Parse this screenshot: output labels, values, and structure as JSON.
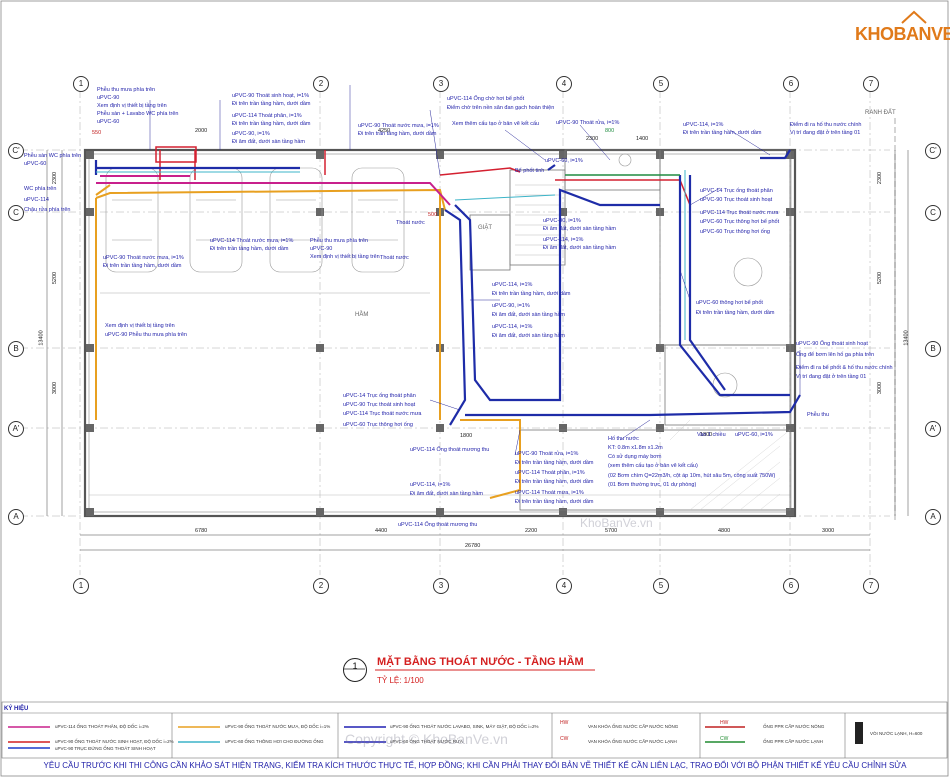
{
  "logo": {
    "text": "KHOBANVE"
  },
  "title": {
    "main": "MẶT BẰNG THOÁT NƯỚC - TẦNG HẦM",
    "scale": "TỶ LỆ: 1/100",
    "number": "1"
  },
  "grid": {
    "top_cols": [
      "1",
      "2",
      "3",
      "4",
      "5",
      "6",
      "7"
    ],
    "bottom_cols": [
      "1",
      "2",
      "3",
      "4",
      "5",
      "6",
      "7"
    ],
    "rows_left": [
      "C'",
      "C",
      "B",
      "A'",
      "A"
    ],
    "rows_right": [
      "C'",
      "C",
      "B",
      "A'",
      "A"
    ]
  },
  "dims": {
    "bottom": [
      "6780",
      "4400",
      "2200",
      "5700",
      "4800",
      "3000"
    ],
    "bottom_total": "26780",
    "top": [
      "2300",
      "1400"
    ],
    "left": [
      "2300",
      "5200",
      "3000",
      "13400"
    ],
    "right": [
      "2300",
      "5200",
      "3000",
      "13400"
    ],
    "misc": [
      "550",
      "1800",
      "4250",
      "500",
      "1800",
      "800",
      "2000"
    ]
  },
  "rooms": {
    "ham": "HẦM",
    "rang_dat": "RANH ĐẤT",
    "giat": "GIẶT"
  },
  "notes": [
    "Phễu thu mưa phía trên",
    "uPVC-90",
    "Xem định vị thiết bị tầng trên",
    "Phễu sàn + Lavabo WC phía trên",
    "uPVC-60",
    "Phễu sàn WC phía trên",
    "WC phía trên",
    "uPVC-114",
    "Chậu rửa phía trên",
    "uPVC-60",
    "Xem định vị thiết bị tầng trên",
    "uPVC-90 Phễu thu mưa phía trên",
    "uPVC-90 Thoát sinh hoạt, i=1%",
    "Đi trên trần tầng hầm, dưới dầm",
    "uPVC-114 Thoát phân, i=1%",
    "Đi trên trần tầng hầm, dưới dầm",
    "uPVC-90, i=1%",
    "Đi âm đất, dưới sàn tầng hầm",
    "uPVC-114 Thoát nước mưa, i=1%",
    "Đi trên trần tầng hầm, dưới dầm",
    "uPVC-90 Thoát nước mưa, i=1%",
    "Đi trên trần tầng hầm, dưới dầm",
    "Phễu thu mưa phía trên",
    "uPVC-90",
    "Xem định vị thiết bị tầng trên",
    "uPVC-114 Ống chờ hơi bể phốt",
    "Điểm chờ trên nền sân đan gạch hoàn thiện",
    "Xem thêm cấu tạo ở bản vẽ kết cấu",
    "uPVC-90 Thoát rửa, i=1%",
    "Bể phốt tinh",
    "uPVC-114, i=1%",
    "Đi trên trần tầng hầm, dưới dầm",
    "Điểm đi ra hố thu nước chính",
    "Vị trí đang đặt ở trên tầng 01",
    "uPVC-14 Trục ống thoát phân",
    "uPVC-90 Trục thoát sinh hoạt",
    "uPVC-114 Trục thoát nước mưa",
    "uPVC-60 Trục thông hơi bể phốt",
    "uPVC-60 Trục thông hơi ống",
    "uPVC-60 thông hơi bể phốt",
    "Đi trên trần tầng hầm, dưới dầm",
    "uPVC-90, i=1%",
    "Đi âm đất, dưới sàn tầng hầm",
    "uPVC-114, i=1%",
    "Đi âm đất, dưới sàn tầng hầm",
    "uPVC-114, i=1%",
    "Đi trên trần tầng hầm, dưới dầm",
    "uPVC-90, i=1%",
    "Đi âm đất, dưới sàn tầng hầm",
    "uPVC-114, i=1%",
    "Đi âm đất, dưới sàn tầng hầm",
    "uPVC-90 Ống thoát sinh hoạt",
    "Ống để bơm lên hố ga phía trên",
    "Điểm đi ra bể phốt & hố thu nước chính",
    "Vị trí đang đặt ở trên tầng 01",
    "uPVC-14 Trục ống thoát phân",
    "uPVC-90 Trục thoát sinh hoạt",
    "uPVC-114 Trục thoát nước mưa",
    "uPVC-60 Trục thông hơi ống",
    "uPVC-114 Ống thoát mương thu",
    "uPVC-90 Thoát rửa, i=1%",
    "Đi trên trần tầng hầm, dưới dầm",
    "uPVC-114 Thoát phân, i=1%",
    "Đi trên trần tầng hầm, dưới dầm",
    "uPVC-114 Thoát mưa, i=1%",
    "Đi trên trần tầng hầm, dưới dầm",
    "uPVC-114, i=1%",
    "Đi âm đất, dưới sàn tầng hầm",
    "uPVC-114 Ống thoát mương thu",
    "Hố thu nước",
    "KT: 0.8m x1.8m x1.2m",
    "Có sử dụng máy bơm",
    "(xem thêm cấu tạo ở bản vẽ kết cấu)",
    "(02 Bơm chìm Q=22m3/h, cột áp 10m, hút sâu 5m, công suất 750W)",
    "(01 Bơm thường trực, 01 dự phòng)",
    "Phễu thu",
    "uPVC-60, i=1%",
    "uPVC-60, i=1%",
    "Thoát nước",
    "Thoát nước",
    "uPVC-90 Thoát nước mưa, i=1%",
    "Đi trên trần tầng hầm, dưới dầm",
    "Van 1 chiều"
  ],
  "legend": {
    "head": "KÝ HIỆU",
    "items": [
      {
        "text": "uPVC-114 ỐNG THOÁT PHÂN, ĐỘ DỐC i=2%",
        "color": "#c8208c"
      },
      {
        "text": "uPVC-90 ỐNG THOÁT NƯỚC SINH HOẠT, ĐỘ DỐC i=2%",
        "color": "#d42020"
      },
      {
        "text": "uPVC-90 TRỤC ĐỨNG ỐNG THOÁT SINH HOẠT",
        "color": "#1e3cc8"
      },
      {
        "text": "uPVC-90 ỐNG THOÁT NƯỚC MƯA, ĐỘ DỐC i=1%",
        "color": "#e8a020"
      },
      {
        "text": "uPVC-60 ỐNG THÔNG HƠI CHO ĐƯỜNG ỐNG",
        "color": "#3cb4c8"
      },
      {
        "text": "uPVC-90 ỐNG THOÁT NƯỚC LAVABO, SINK, MÁY GIẶT, ĐỘ DỐC i=2%",
        "color": "#2020b4"
      },
      {
        "text": "uPVC-60 ỐNG THOÁT NƯỚC RỬA",
        "color": "#2020b4"
      },
      {
        "text": "VAN KHÓA ỐNG NƯỚC CẤP NƯỚC NÓNG",
        "color": "#c02020"
      },
      {
        "text": "VAN KHÓA ỐNG NƯỚC CẤP NƯỚC LẠNH",
        "color": "#c02020"
      },
      {
        "text": "ỐNG PPR CẤP NƯỚC NÓNG",
        "color": "#c02020"
      },
      {
        "text": "ỐNG PPR CẤP NƯỚC LẠNH",
        "color": "#208c30"
      },
      {
        "text": "VÒI NƯỚC LẠNH, H=600",
        "color": "#333"
      }
    ],
    "tags": [
      "HW",
      "CW"
    ]
  },
  "footer": "YÊU CẦU TRƯỚC KHI THI CÔNG CẦN KHẢO SÁT HIỆN TRẠNG, KIỂM TRA  KÍCH THƯỚC THỰC TẾ, HỢP ĐỒNG; KHI CẦN PHẢI THAY ĐỔI BẢN VẼ THIẾT KẾ CẦN LIÊN LẠC, TRAO ĐỔI VỚI BỘ PHẬN THIẾT KẾ YÊU CẦU CHỈNH SỬA",
  "watermarks": [
    "Copyright © KhoBanVe.vn",
    "KhoBanVe.vn"
  ],
  "colors": {
    "blue": "#1e2ca8",
    "red": "#d42030",
    "magenta": "#c8208c",
    "orange": "#e8a020",
    "cyan": "#3cb4c8",
    "green": "#208c40",
    "wall": "#555555"
  }
}
